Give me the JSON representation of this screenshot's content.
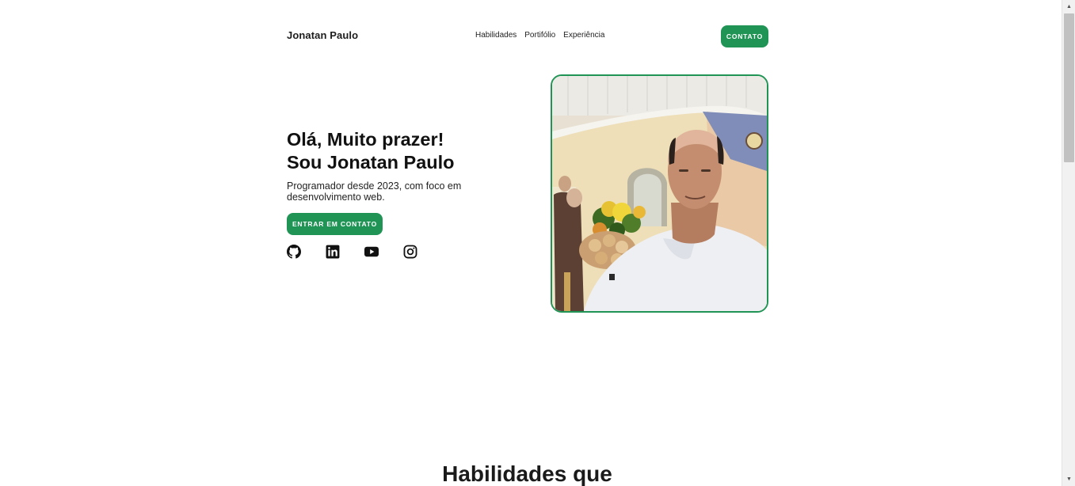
{
  "header": {
    "brand": "Jonatan Paulo",
    "nav": [
      "Habilidades",
      "Portifólio",
      "Experiência"
    ],
    "contact_button": "CONTATO"
  },
  "hero": {
    "title_line1": "Olá, Muito prazer!",
    "title_line2": "Sou Jonatan Paulo",
    "subtitle": "Programador desde 2023, com foco em desenvolvimento web.",
    "cta_button": "ENTRAR EM CONTATO",
    "socials": [
      "github-icon",
      "linkedin-icon",
      "youtube-icon",
      "instagram-icon"
    ]
  },
  "skills": {
    "heading": "Habilidades que"
  },
  "colors": {
    "accent": "#1f9455",
    "text": "#111111"
  }
}
